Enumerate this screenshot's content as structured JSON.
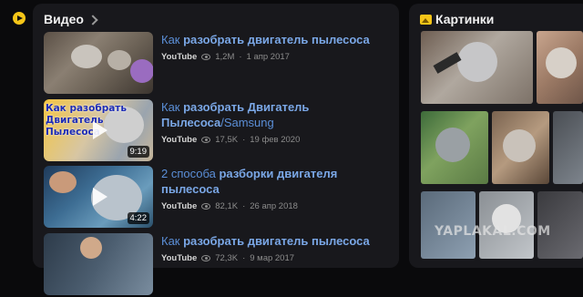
{
  "left_rail": {
    "icon": "play-circle-icon",
    "accent": "#f5c518"
  },
  "videos": {
    "heading": "Видео",
    "items": [
      {
        "title_parts": [
          {
            "text": "Как ",
            "bold": false
          },
          {
            "text": "разобрать двигатель пылесоса",
            "bold": true
          }
        ],
        "source": "YouTube",
        "views": "1,2М",
        "date": "1 апр 2017",
        "duration": ""
      },
      {
        "title_parts": [
          {
            "text": "Как ",
            "bold": false
          },
          {
            "text": "разобрать Двигатель Пылесоса",
            "bold": true
          },
          {
            "text": "/Samsung",
            "bold": false
          }
        ],
        "source": "YouTube",
        "views": "17,5K",
        "date": "19 фев 2020",
        "duration": "9:19",
        "thumb_caption": "Как разобрать\nДвигатель\nПылесоса"
      },
      {
        "title_parts": [
          {
            "text": "2 способа ",
            "bold": false
          },
          {
            "text": "разборки двигателя пылесоса",
            "bold": true
          }
        ],
        "source": "YouTube",
        "views": "82,1K",
        "date": "26 апр 2018",
        "duration": "4:22"
      },
      {
        "title_parts": [
          {
            "text": "Как ",
            "bold": false
          },
          {
            "text": "разобрать двигатель пылесоса",
            "bold": true
          }
        ],
        "source": "YouTube",
        "views": "72,3K",
        "date": "9 мар 2017",
        "duration": ""
      }
    ]
  },
  "images": {
    "heading": "Картинки",
    "icon": "image-icon"
  },
  "watermark": "YAPLAKAL.COM"
}
